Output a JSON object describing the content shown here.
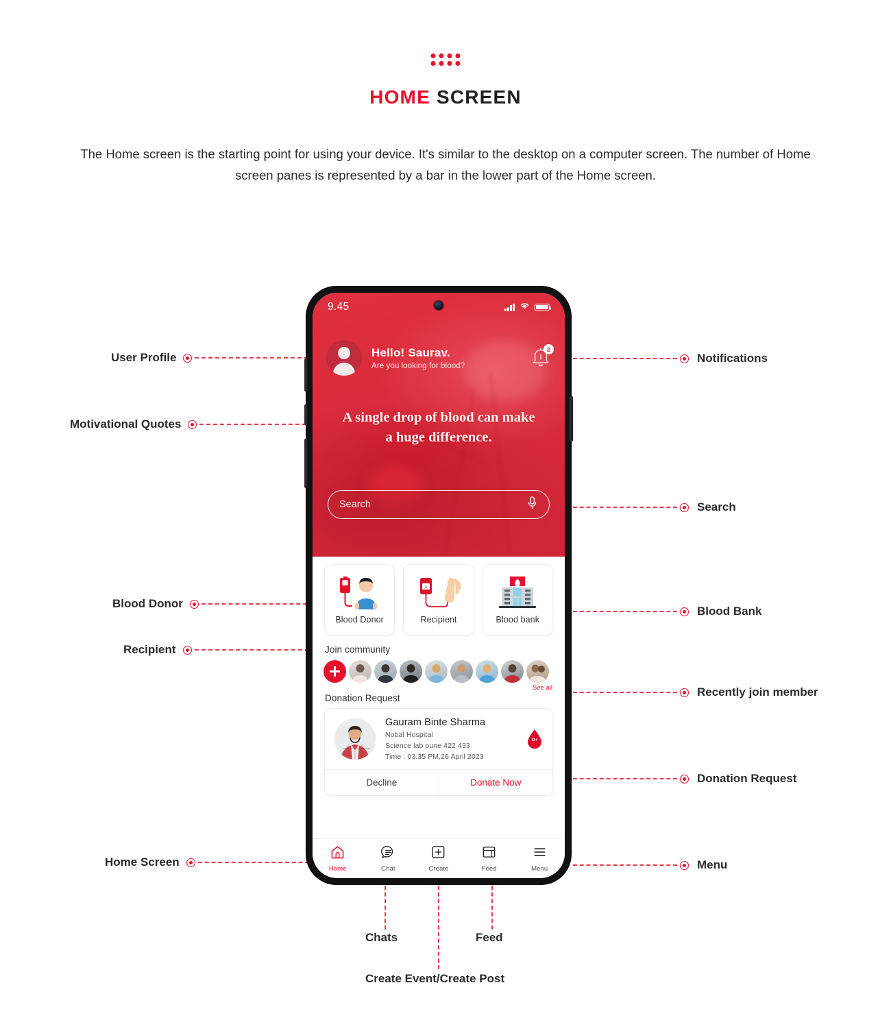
{
  "header": {
    "dots_icon": "dots-grid-icon",
    "title_highlight": "HOME",
    "title_rest": " SCREEN",
    "description": "The Home screen is the starting point for using your device. It's similar to the desktop on a computer screen. The number of Home screen panes is represented by a bar in the lower part of the Home screen."
  },
  "colors": {
    "accent_red": "#e8112d",
    "hero_red": "#d92b3b",
    "leader_red": "#ef3b4b",
    "text_dark": "#2b2b2b"
  },
  "callouts": {
    "left": [
      {
        "label": "User Profile"
      },
      {
        "label": "Motivational Quotes"
      },
      {
        "label": "Blood Donor"
      },
      {
        "label": "Recipient"
      },
      {
        "label": "Home Screen"
      }
    ],
    "right": [
      {
        "label": "Notifications"
      },
      {
        "label": "Search"
      },
      {
        "label": "Blood Bank"
      },
      {
        "label": "Recently join member"
      },
      {
        "label": "Donation Request"
      },
      {
        "label": "Menu"
      }
    ],
    "bottom": [
      {
        "label": "Chats"
      },
      {
        "label": "Feed"
      },
      {
        "label": "Create Event/Create Post"
      }
    ]
  },
  "phone": {
    "status_bar": {
      "time": "9.45",
      "signal_icon": "cellular-signal-icon",
      "wifi_icon": "wifi-icon",
      "battery_icon": "battery-full-icon"
    },
    "greeting": {
      "avatar_icon": "user-avatar-icon",
      "hello": "Hello! Saurav.",
      "subtitle": "Are you looking for blood?",
      "bell_icon": "notification-bell-icon",
      "badge_count": "2"
    },
    "quote": "A single drop of blood can make a huge difference.",
    "search": {
      "placeholder": "Search",
      "value": "",
      "mic_icon": "microphone-icon"
    },
    "categories": [
      {
        "label": "Blood Donor",
        "icon": "blood-donor-icon"
      },
      {
        "label": "Recipient",
        "icon": "blood-recipient-icon"
      },
      {
        "label": "Blood bank",
        "icon": "blood-bank-icon"
      }
    ],
    "community": {
      "title": "Join community",
      "add_icon": "add-member-icon",
      "see_all": "See all",
      "member_count": 8
    },
    "donation": {
      "section_title": "Donation Request",
      "name": "Gauram Binte Sharma",
      "hospital": "Nobal Hospital",
      "address": "Science lab pune 422 433",
      "time": "Time : 03.35 PM,26 April 2023",
      "blood_group": "O+",
      "blood_drop_icon": "blood-drop-icon",
      "decline_label": "Decline",
      "donate_label": "Donate Now"
    },
    "nav": [
      {
        "label": "Home",
        "icon": "home-icon",
        "active": true
      },
      {
        "label": "Chat",
        "icon": "chat-icon",
        "active": false
      },
      {
        "label": "Create",
        "icon": "plus-box-icon",
        "active": false
      },
      {
        "label": "Feed",
        "icon": "feed-icon",
        "active": false
      },
      {
        "label": "Menu",
        "icon": "hamburger-menu-icon",
        "active": false
      }
    ]
  }
}
